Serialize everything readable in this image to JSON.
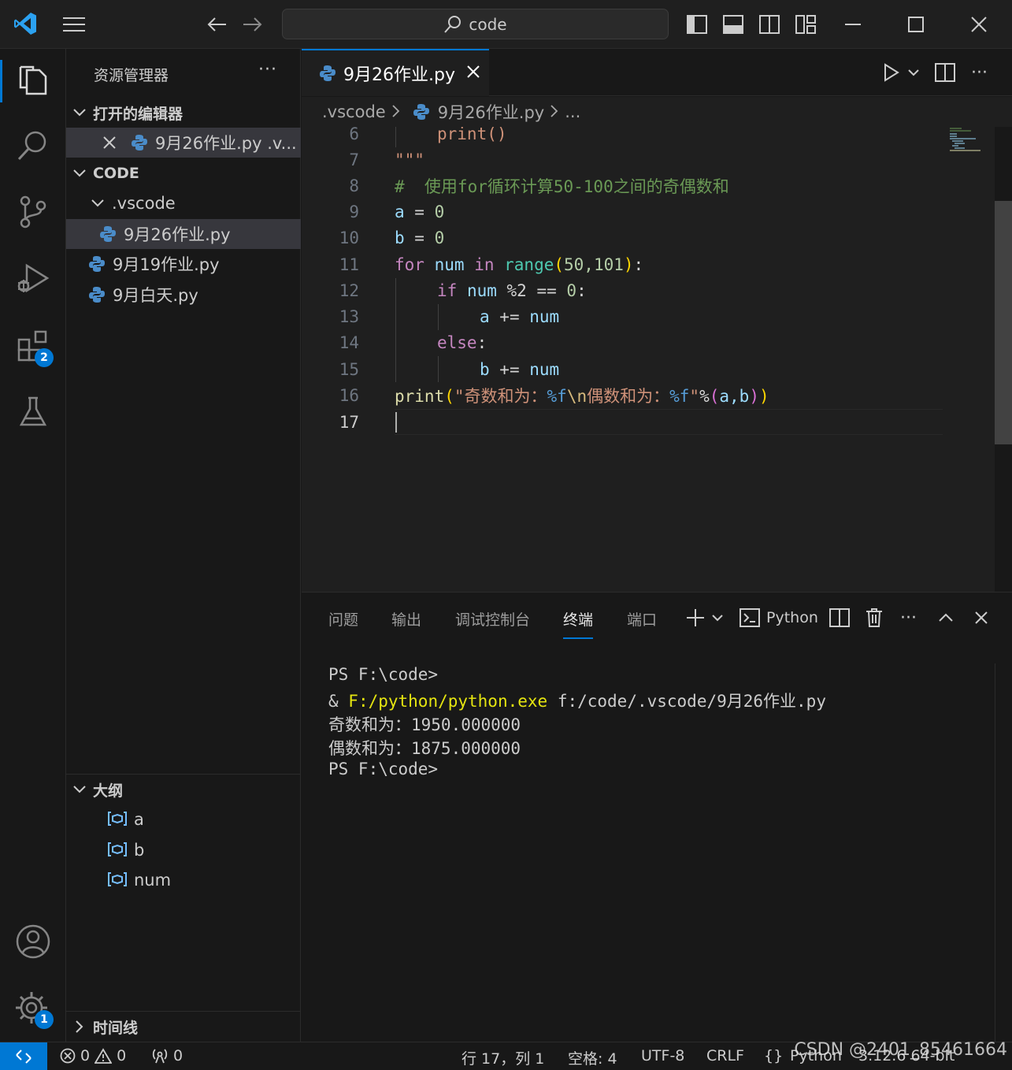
{
  "titlebar": {
    "search_text": "code"
  },
  "activity": {
    "extensions_badge": "2",
    "settings_badge": "1"
  },
  "sidebar": {
    "title": "资源管理器",
    "open_editors_header": "打开的编辑器",
    "open_editor_item": "9月26作业.py  .v...",
    "workspace_header": "CODE",
    "folder_vscode": ".vscode",
    "files": [
      "9月26作业.py",
      "9月19作业.py",
      "9月白天.py"
    ],
    "outline_header": "大纲",
    "outline_items": [
      "a",
      "b",
      "num"
    ],
    "timeline_header": "时间线"
  },
  "tab": {
    "label": "9月26作业.py"
  },
  "breadcrumb": {
    "folder": ".vscode",
    "file": "9月26作业.py",
    "more": "..."
  },
  "editor": {
    "line_numbers": [
      "6",
      "7",
      "8",
      "9",
      "10",
      "11",
      "12",
      "13",
      "14",
      "15",
      "16",
      "17"
    ],
    "line6": "print()",
    "line7": "\"\"\"",
    "line8_comment": "#  使用for循环计算50-100之间的奇偶数和",
    "line9": {
      "var": "a",
      "op": " = ",
      "num": "0"
    },
    "line10": {
      "var": "b",
      "op": " = ",
      "num": "0"
    },
    "line11": {
      "kw": "for",
      "var": "num",
      "kw_in": "in",
      "fn": "range",
      "args": "50,101",
      "tail": ":"
    },
    "line12": {
      "kw": "if",
      "var": "num",
      "rest": " %2 == ",
      "num": "0",
      "tail": ":"
    },
    "line13": {
      "var": "a",
      "op": " += ",
      "var2": "num"
    },
    "line14": {
      "kw": "else",
      "tail": ":"
    },
    "line15": {
      "var": "b",
      "op": " += ",
      "var2": "num"
    },
    "line16": {
      "fn": "print",
      "str1": "\"奇数和为：",
      "fmt1": "%f",
      "esc": "\\n",
      "str2": "偶数和为：",
      "fmt2": "%f",
      "str3": "\"",
      "op": "%",
      "args": "a,b"
    }
  },
  "panel": {
    "tabs": [
      "问题",
      "输出",
      "调试控制台",
      "终端",
      "端口"
    ],
    "terminal_profile": "Python",
    "terminal_lines": {
      "l1": "PS F:\\code>",
      "l2_amp": "& ",
      "l2_exe": "F:/python/python.exe",
      "l2_arg": " f:/code/.vscode/9月26作业.py",
      "l3": "奇数和为：1950.000000",
      "l4": "偶数和为：1875.000000",
      "l5": "PS F:\\code>"
    }
  },
  "statusbar": {
    "errors": "0",
    "warnings": "0",
    "ports": "0",
    "position": "行 17，列 1",
    "spaces": "空格: 4",
    "encoding": "UTF-8",
    "eol": "CRLF",
    "lang_braces": "{}",
    "language": "Python",
    "interpreter": "3.12.6 64-bit"
  },
  "watermark": "CSDN @2401_85461664"
}
